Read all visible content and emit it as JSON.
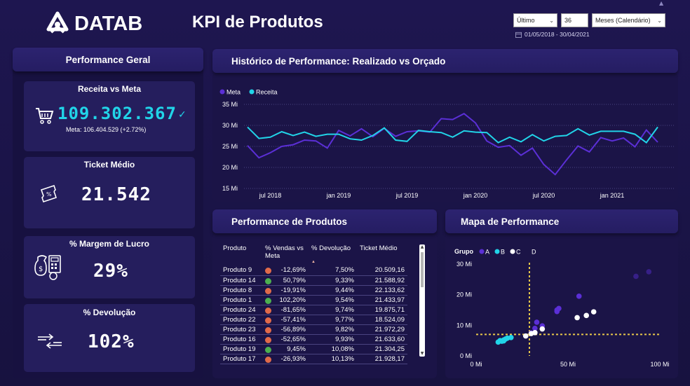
{
  "header": {
    "brand": "DATAB",
    "title": "KPI de Produtos"
  },
  "filters": {
    "period_type": "Último",
    "period_count": "36",
    "period_unit": "Meses (Calendário)",
    "date_range": "01/05/2018 - 30/04/2021"
  },
  "left": {
    "title": "Performance Geral",
    "cards": {
      "receita": {
        "title": "Receita vs Meta",
        "value": "109.302.367",
        "check": "✓",
        "sub": "Meta: 106.404.529 (+2.72%)"
      },
      "ticket": {
        "title": "Ticket Médio",
        "value": "21.542"
      },
      "margem": {
        "title": "% Margem de Lucro",
        "value": "29%"
      },
      "devolucao": {
        "title": "% Devolução",
        "value": "102%"
      }
    }
  },
  "colors": {
    "meta": "#5b2fd6",
    "receita": "#21d4e8",
    "green": "#4caf50",
    "red": "#e06a4a",
    "grupo_a": "#5b2fd6",
    "grupo_b": "#21d4e8",
    "grupo_c": "#ffffff",
    "threshold": "#e8c84a"
  },
  "history": {
    "title": "Histórico de Performance: Realizado vs Orçado"
  },
  "products": {
    "title": "Performance de Produtos",
    "columns": [
      "Produto",
      "% Vendas vs Meta",
      "% Devolução",
      "Ticket Médio"
    ],
    "rows": [
      {
        "name": "Produto 9",
        "status": "red",
        "vendas": "-12,69%",
        "devolucao": "7,50%",
        "ticket": "20.509,16"
      },
      {
        "name": "Produto 14",
        "status": "green",
        "vendas": "50,79%",
        "devolucao": "9,33%",
        "ticket": "21.588,92"
      },
      {
        "name": "Produto 8",
        "status": "red",
        "vendas": "-19,91%",
        "devolucao": "9,44%",
        "ticket": "22.133,62"
      },
      {
        "name": "Produto 1",
        "status": "green",
        "vendas": "102,20%",
        "devolucao": "9,54%",
        "ticket": "21.433,97"
      },
      {
        "name": "Produto 24",
        "status": "red",
        "vendas": "-81,65%",
        "devolucao": "9,74%",
        "ticket": "19.875,71"
      },
      {
        "name": "Produto 22",
        "status": "red",
        "vendas": "-57,41%",
        "devolucao": "9,77%",
        "ticket": "18.524,09"
      },
      {
        "name": "Produto 23",
        "status": "red",
        "vendas": "-56,89%",
        "devolucao": "9,82%",
        "ticket": "21.972,29"
      },
      {
        "name": "Produto 16",
        "status": "red",
        "vendas": "-52,65%",
        "devolucao": "9,93%",
        "ticket": "21.633,60"
      },
      {
        "name": "Produto 19",
        "status": "green",
        "vendas": "9,45%",
        "devolucao": "10,08%",
        "ticket": "21.304,25"
      },
      {
        "name": "Produto 17",
        "status": "red",
        "vendas": "-26,93%",
        "devolucao": "10,13%",
        "ticket": "21.928,17"
      }
    ]
  },
  "map": {
    "title": "Mapa de Performance"
  },
  "chart_data": [
    {
      "type": "line",
      "title": "Histórico de Performance: Realizado vs Orçado",
      "ylim": [
        15,
        35
      ],
      "yticks": [
        "15 Mi",
        "20 Mi",
        "25 Mi",
        "30 Mi",
        "35 Mi"
      ],
      "xticks": [
        "jul 2018",
        "jan 2019",
        "jul 2019",
        "jan 2020",
        "jul 2020",
        "jan 2021"
      ],
      "legend": "top-left",
      "grid": true,
      "x": [
        "2018-05",
        "2018-06",
        "2018-07",
        "2018-08",
        "2018-09",
        "2018-10",
        "2018-11",
        "2018-12",
        "2019-01",
        "2019-02",
        "2019-03",
        "2019-04",
        "2019-05",
        "2019-06",
        "2019-07",
        "2019-08",
        "2019-09",
        "2019-10",
        "2019-11",
        "2019-12",
        "2020-01",
        "2020-02",
        "2020-03",
        "2020-04",
        "2020-05",
        "2020-06",
        "2020-07",
        "2020-08",
        "2020-09",
        "2020-10",
        "2020-11",
        "2020-12",
        "2021-01",
        "2021-02",
        "2021-03",
        "2021-04"
      ],
      "series": [
        {
          "name": "Meta",
          "values": [
            25.2,
            22.3,
            23.5,
            25.0,
            25.4,
            26.5,
            26.3,
            24.6,
            28.8,
            27.5,
            29.2,
            27.3,
            29.3,
            27.4,
            28.5,
            28.7,
            28.4,
            31.6,
            31.4,
            32.8,
            30.6,
            26.3,
            24.8,
            25.2,
            22.9,
            24.6,
            20.7,
            18.3,
            21.8,
            25.1,
            23.7,
            27.1,
            26.3,
            27.0,
            24.9,
            28.9,
            26.0
          ]
        },
        {
          "name": "Receita",
          "values": [
            29.6,
            26.9,
            27.2,
            28.5,
            27.6,
            28.4,
            27.4,
            27.9,
            27.9,
            26.8,
            26.5,
            27.6,
            29.4,
            26.5,
            26.2,
            28.8,
            28.5,
            28.3,
            27.2,
            28.7,
            28.4,
            28.3,
            25.9,
            27.2,
            26.1,
            27.8,
            26.3,
            27.4,
            27.6,
            29.2,
            27.7,
            28.6,
            28.6,
            28.6,
            27.9,
            25.9,
            29.6,
            26.0
          ]
        }
      ]
    },
    {
      "type": "scatter",
      "title": "Mapa de Performance",
      "xlim": [
        0,
        100
      ],
      "ylim": [
        0,
        30
      ],
      "xticks": [
        "0 Mi",
        "50 Mi",
        "100 Mi"
      ],
      "yticks": [
        "0 Mi",
        "10 Mi",
        "20 Mi",
        "30 Mi"
      ],
      "legend_title": "Grupo",
      "thresholds": {
        "x": 29,
        "y": 7
      },
      "series": [
        {
          "name": "A",
          "points": [
            [
              30,
              7.5
            ],
            [
              33,
              11
            ],
            [
              32,
              9
            ],
            [
              36,
              9.8
            ],
            [
              44,
              15
            ],
            [
              45,
              15.5
            ],
            [
              56,
              19.5
            ],
            [
              87,
              26
            ],
            [
              94,
              27.5
            ],
            [
              44,
              14.5
            ]
          ]
        },
        {
          "name": "B",
          "points": [
            [
              12,
              4.5
            ],
            [
              13,
              5
            ],
            [
              14,
              4.8
            ],
            [
              15,
              5.2
            ],
            [
              16,
              5.5
            ],
            [
              17,
              5.8
            ],
            [
              19,
              6
            ],
            [
              15,
              4.9
            ]
          ]
        },
        {
          "name": "C",
          "points": [
            [
              27,
              6.5
            ],
            [
              30,
              7.3
            ],
            [
              32,
              7.6
            ],
            [
              36,
              8.8
            ],
            [
              55,
              12.5
            ],
            [
              60,
              13.2
            ],
            [
              64,
              14.4
            ]
          ]
        },
        {
          "name": "D",
          "points": []
        }
      ]
    }
  ]
}
